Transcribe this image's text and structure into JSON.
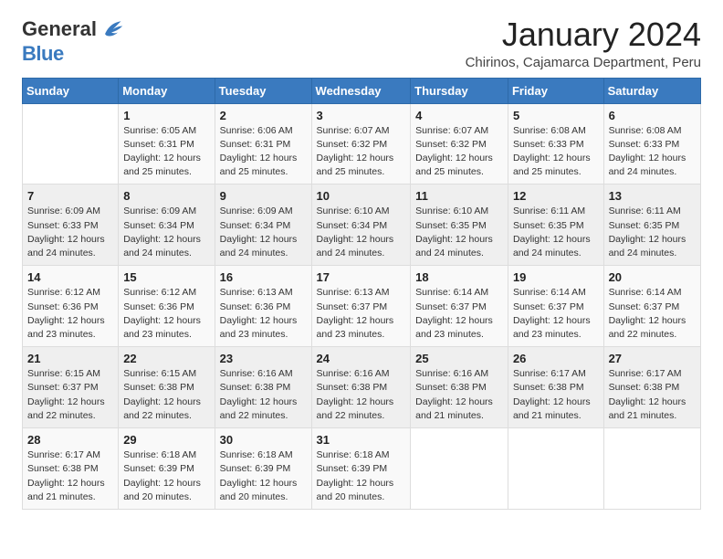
{
  "header": {
    "logo_line1": "General",
    "logo_line2": "Blue",
    "month_title": "January 2024",
    "subtitle": "Chirinos, Cajamarca Department, Peru"
  },
  "calendar": {
    "days_of_week": [
      "Sunday",
      "Monday",
      "Tuesday",
      "Wednesday",
      "Thursday",
      "Friday",
      "Saturday"
    ],
    "weeks": [
      [
        {
          "day": "",
          "info": ""
        },
        {
          "day": "1",
          "info": "Sunrise: 6:05 AM\nSunset: 6:31 PM\nDaylight: 12 hours and 25 minutes."
        },
        {
          "day": "2",
          "info": "Sunrise: 6:06 AM\nSunset: 6:31 PM\nDaylight: 12 hours and 25 minutes."
        },
        {
          "day": "3",
          "info": "Sunrise: 6:07 AM\nSunset: 6:32 PM\nDaylight: 12 hours and 25 minutes."
        },
        {
          "day": "4",
          "info": "Sunrise: 6:07 AM\nSunset: 6:32 PM\nDaylight: 12 hours and 25 minutes."
        },
        {
          "day": "5",
          "info": "Sunrise: 6:08 AM\nSunset: 6:33 PM\nDaylight: 12 hours and 25 minutes."
        },
        {
          "day": "6",
          "info": "Sunrise: 6:08 AM\nSunset: 6:33 PM\nDaylight: 12 hours and 24 minutes."
        }
      ],
      [
        {
          "day": "7",
          "info": "Sunrise: 6:09 AM\nSunset: 6:33 PM\nDaylight: 12 hours and 24 minutes."
        },
        {
          "day": "8",
          "info": "Sunrise: 6:09 AM\nSunset: 6:34 PM\nDaylight: 12 hours and 24 minutes."
        },
        {
          "day": "9",
          "info": "Sunrise: 6:09 AM\nSunset: 6:34 PM\nDaylight: 12 hours and 24 minutes."
        },
        {
          "day": "10",
          "info": "Sunrise: 6:10 AM\nSunset: 6:34 PM\nDaylight: 12 hours and 24 minutes."
        },
        {
          "day": "11",
          "info": "Sunrise: 6:10 AM\nSunset: 6:35 PM\nDaylight: 12 hours and 24 minutes."
        },
        {
          "day": "12",
          "info": "Sunrise: 6:11 AM\nSunset: 6:35 PM\nDaylight: 12 hours and 24 minutes."
        },
        {
          "day": "13",
          "info": "Sunrise: 6:11 AM\nSunset: 6:35 PM\nDaylight: 12 hours and 24 minutes."
        }
      ],
      [
        {
          "day": "14",
          "info": "Sunrise: 6:12 AM\nSunset: 6:36 PM\nDaylight: 12 hours and 23 minutes."
        },
        {
          "day": "15",
          "info": "Sunrise: 6:12 AM\nSunset: 6:36 PM\nDaylight: 12 hours and 23 minutes."
        },
        {
          "day": "16",
          "info": "Sunrise: 6:13 AM\nSunset: 6:36 PM\nDaylight: 12 hours and 23 minutes."
        },
        {
          "day": "17",
          "info": "Sunrise: 6:13 AM\nSunset: 6:37 PM\nDaylight: 12 hours and 23 minutes."
        },
        {
          "day": "18",
          "info": "Sunrise: 6:14 AM\nSunset: 6:37 PM\nDaylight: 12 hours and 23 minutes."
        },
        {
          "day": "19",
          "info": "Sunrise: 6:14 AM\nSunset: 6:37 PM\nDaylight: 12 hours and 23 minutes."
        },
        {
          "day": "20",
          "info": "Sunrise: 6:14 AM\nSunset: 6:37 PM\nDaylight: 12 hours and 22 minutes."
        }
      ],
      [
        {
          "day": "21",
          "info": "Sunrise: 6:15 AM\nSunset: 6:37 PM\nDaylight: 12 hours and 22 minutes."
        },
        {
          "day": "22",
          "info": "Sunrise: 6:15 AM\nSunset: 6:38 PM\nDaylight: 12 hours and 22 minutes."
        },
        {
          "day": "23",
          "info": "Sunrise: 6:16 AM\nSunset: 6:38 PM\nDaylight: 12 hours and 22 minutes."
        },
        {
          "day": "24",
          "info": "Sunrise: 6:16 AM\nSunset: 6:38 PM\nDaylight: 12 hours and 22 minutes."
        },
        {
          "day": "25",
          "info": "Sunrise: 6:16 AM\nSunset: 6:38 PM\nDaylight: 12 hours and 21 minutes."
        },
        {
          "day": "26",
          "info": "Sunrise: 6:17 AM\nSunset: 6:38 PM\nDaylight: 12 hours and 21 minutes."
        },
        {
          "day": "27",
          "info": "Sunrise: 6:17 AM\nSunset: 6:38 PM\nDaylight: 12 hours and 21 minutes."
        }
      ],
      [
        {
          "day": "28",
          "info": "Sunrise: 6:17 AM\nSunset: 6:38 PM\nDaylight: 12 hours and 21 minutes."
        },
        {
          "day": "29",
          "info": "Sunrise: 6:18 AM\nSunset: 6:39 PM\nDaylight: 12 hours and 20 minutes."
        },
        {
          "day": "30",
          "info": "Sunrise: 6:18 AM\nSunset: 6:39 PM\nDaylight: 12 hours and 20 minutes."
        },
        {
          "day": "31",
          "info": "Sunrise: 6:18 AM\nSunset: 6:39 PM\nDaylight: 12 hours and 20 minutes."
        },
        {
          "day": "",
          "info": ""
        },
        {
          "day": "",
          "info": ""
        },
        {
          "day": "",
          "info": ""
        }
      ]
    ]
  }
}
